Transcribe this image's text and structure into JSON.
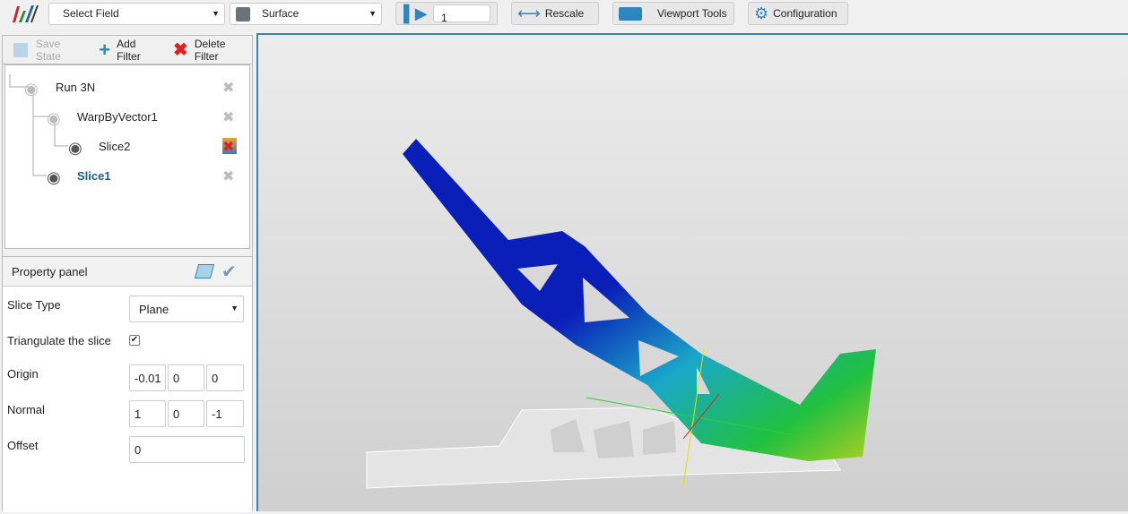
{
  "toolbar": {
    "field_select": "Select Field",
    "representation_select": "Surface",
    "time_value": "1",
    "rescale": "Rescale",
    "viewport_tools": "Viewport Tools",
    "configuration": "Configuration"
  },
  "filter_toolbar": {
    "save_state": "Save State",
    "add_filter": "Add Filter",
    "delete_filter": "Delete Filter"
  },
  "pipeline": [
    {
      "label": "Run 3N"
    },
    {
      "label": "WarpByVector1"
    },
    {
      "label": "Slice2"
    },
    {
      "label": "Slice1",
      "selected": true
    }
  ],
  "property_panel": {
    "title": "Property panel",
    "slice_type_label": "Slice Type",
    "slice_type": "Plane",
    "triangulate_label": "Triangulate the slice",
    "triangulate": true,
    "origin_label": "Origin",
    "origin": [
      "-0.01",
      "0",
      "0"
    ],
    "normal_label": "Normal",
    "normal": [
      "1",
      "0",
      "-1"
    ],
    "offset_label": "Offset",
    "offset": "0"
  },
  "colors": {
    "accent": "#3a84b5",
    "selected_text": "#1a5e8a"
  }
}
